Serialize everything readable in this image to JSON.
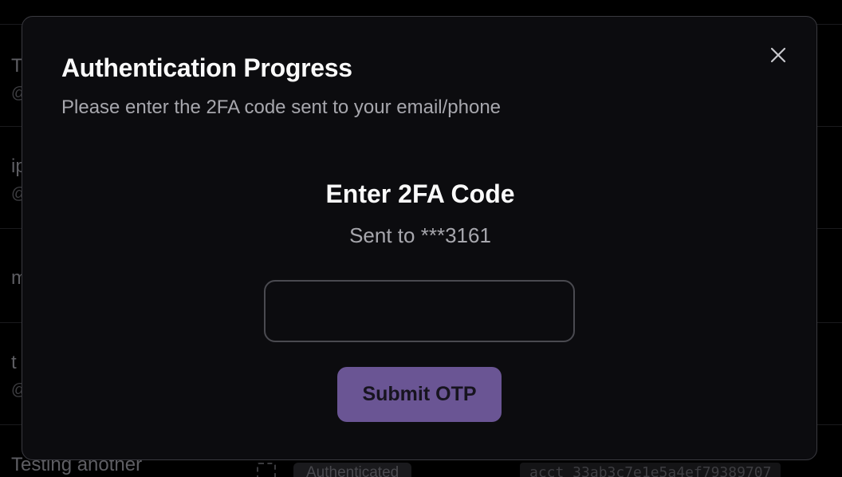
{
  "background": {
    "rows": [
      {
        "name": "T",
        "handle": "@",
        "id": "a30"
      },
      {
        "name": "ip",
        "handle": "@",
        "id": "847"
      },
      {
        "name": "m",
        "handle": "",
        "id": "570"
      },
      {
        "name": "t",
        "handle": "@",
        "id": "e54"
      }
    ],
    "bottom_row": {
      "name": "Testing another",
      "status": "Authenticated",
      "account_id": "acct_33ab3c7e1e5a4ef79389707"
    }
  },
  "modal": {
    "title": "Authentication Progress",
    "subtitle": "Please enter the 2FA code sent to your email/phone",
    "close_icon": "close-icon",
    "otp": {
      "heading": "Enter 2FA Code",
      "sent_to": "Sent to ***3161",
      "slots": [
        "",
        "",
        "",
        "",
        ""
      ]
    },
    "submit_label": "Submit OTP"
  },
  "colors": {
    "modal_background": "#0c0c0f",
    "modal_border": "#3a3a40",
    "submit_button": "#6a5594",
    "title_text": "#fafafa",
    "muted_text": "#a7a7ad"
  }
}
